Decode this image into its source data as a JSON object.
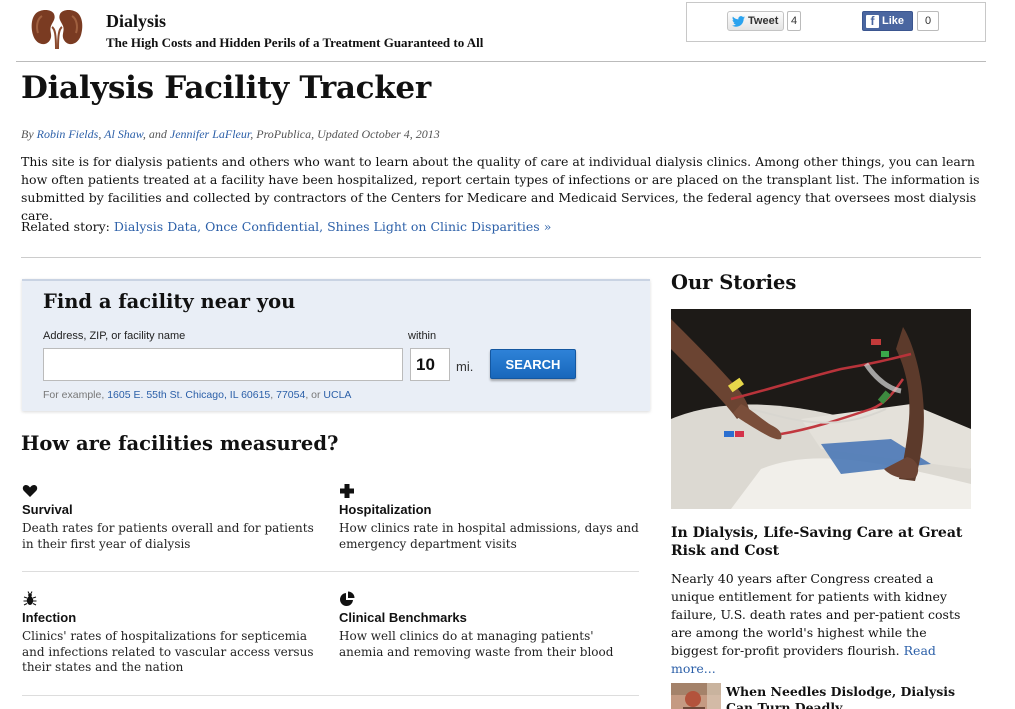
{
  "header": {
    "site_title": "Dialysis",
    "site_subtitle": "The High Costs and Hidden Perils of a Treatment Guaranteed to All",
    "logo_icon": "kidneys-icon"
  },
  "social": {
    "tweet_label": "Tweet",
    "tweet_count": "4",
    "like_label": "Like",
    "like_count": "0",
    "twitter_color": "#2aa3ef",
    "facebook_color": "#4a66a0"
  },
  "article": {
    "title": "Dialysis Facility Tracker",
    "byline_prefix": "By",
    "authors": [
      "Robin Fields",
      "Al Shaw",
      "Jennifer LaFleur"
    ],
    "byline_sep1": ",",
    "byline_sep2": ", and",
    "byline_suffix": ", ProPublica, Updated October 4, 2013",
    "intro": "This site is for dialysis patients and others who want to learn about the quality of care at individual dialysis clinics. Among other things, you can learn how often patients treated at a facility have been hospitalized, report certain types of infections or are placed on the transplant list. The information is submitted by facilities and collected by contractors of the Centers for Medicare and Medicaid Services, the federal agency that oversees most dialysis care.",
    "related_label": "Related story:",
    "related_link": "Dialysis Data, Once Confidential, Shines Light on Clinic Disparities »"
  },
  "search": {
    "heading": "Find a facility near you",
    "address_label": "Address, ZIP, or facility name",
    "address_value": "",
    "within_label": "within",
    "distance_value": "10",
    "unit_label": "mi.",
    "button_label": "SEARCH",
    "example_prefix": "For example,",
    "examples": [
      "1605 E. 55th St. Chicago, IL 60615",
      "77054",
      "UCLA"
    ],
    "example_sep1": ",",
    "example_sep2": ", or",
    "accent_color": "#1f72c9"
  },
  "measures": {
    "heading": "How are facilities measured?",
    "items": [
      {
        "icon": "heart-icon",
        "title": "Survival",
        "desc": "Death rates for patients overall and for patients in their first year of dialysis"
      },
      {
        "icon": "plus-icon",
        "title": "Hospitalization",
        "desc": "How clinics rate in hospital admissions, days and emergency department visits"
      },
      {
        "icon": "bug-icon",
        "title": "Infection",
        "desc": "Clinics' rates of hospitalizations for septicemia and infections related to vascular access versus their states and the nation"
      },
      {
        "icon": "pie-chart-icon",
        "title": "Clinical Benchmarks",
        "desc": "How well clinics do at managing patients' anemia and removing waste from their blood"
      }
    ]
  },
  "sidebar": {
    "heading": "Our Stories",
    "story1": {
      "title": "In Dialysis, Life-Saving Care at Great Risk and Cost",
      "desc": "Nearly 40 years after Congress created a unique entitlement for patients with kidney failure, U.S. death rates and per-patient costs are among the world's highest while the biggest for-profit providers flourish.",
      "read_more": "Read more..."
    },
    "story2": {
      "title": "When Needles Dislodge, Dialysis Can Turn Deadly"
    }
  }
}
